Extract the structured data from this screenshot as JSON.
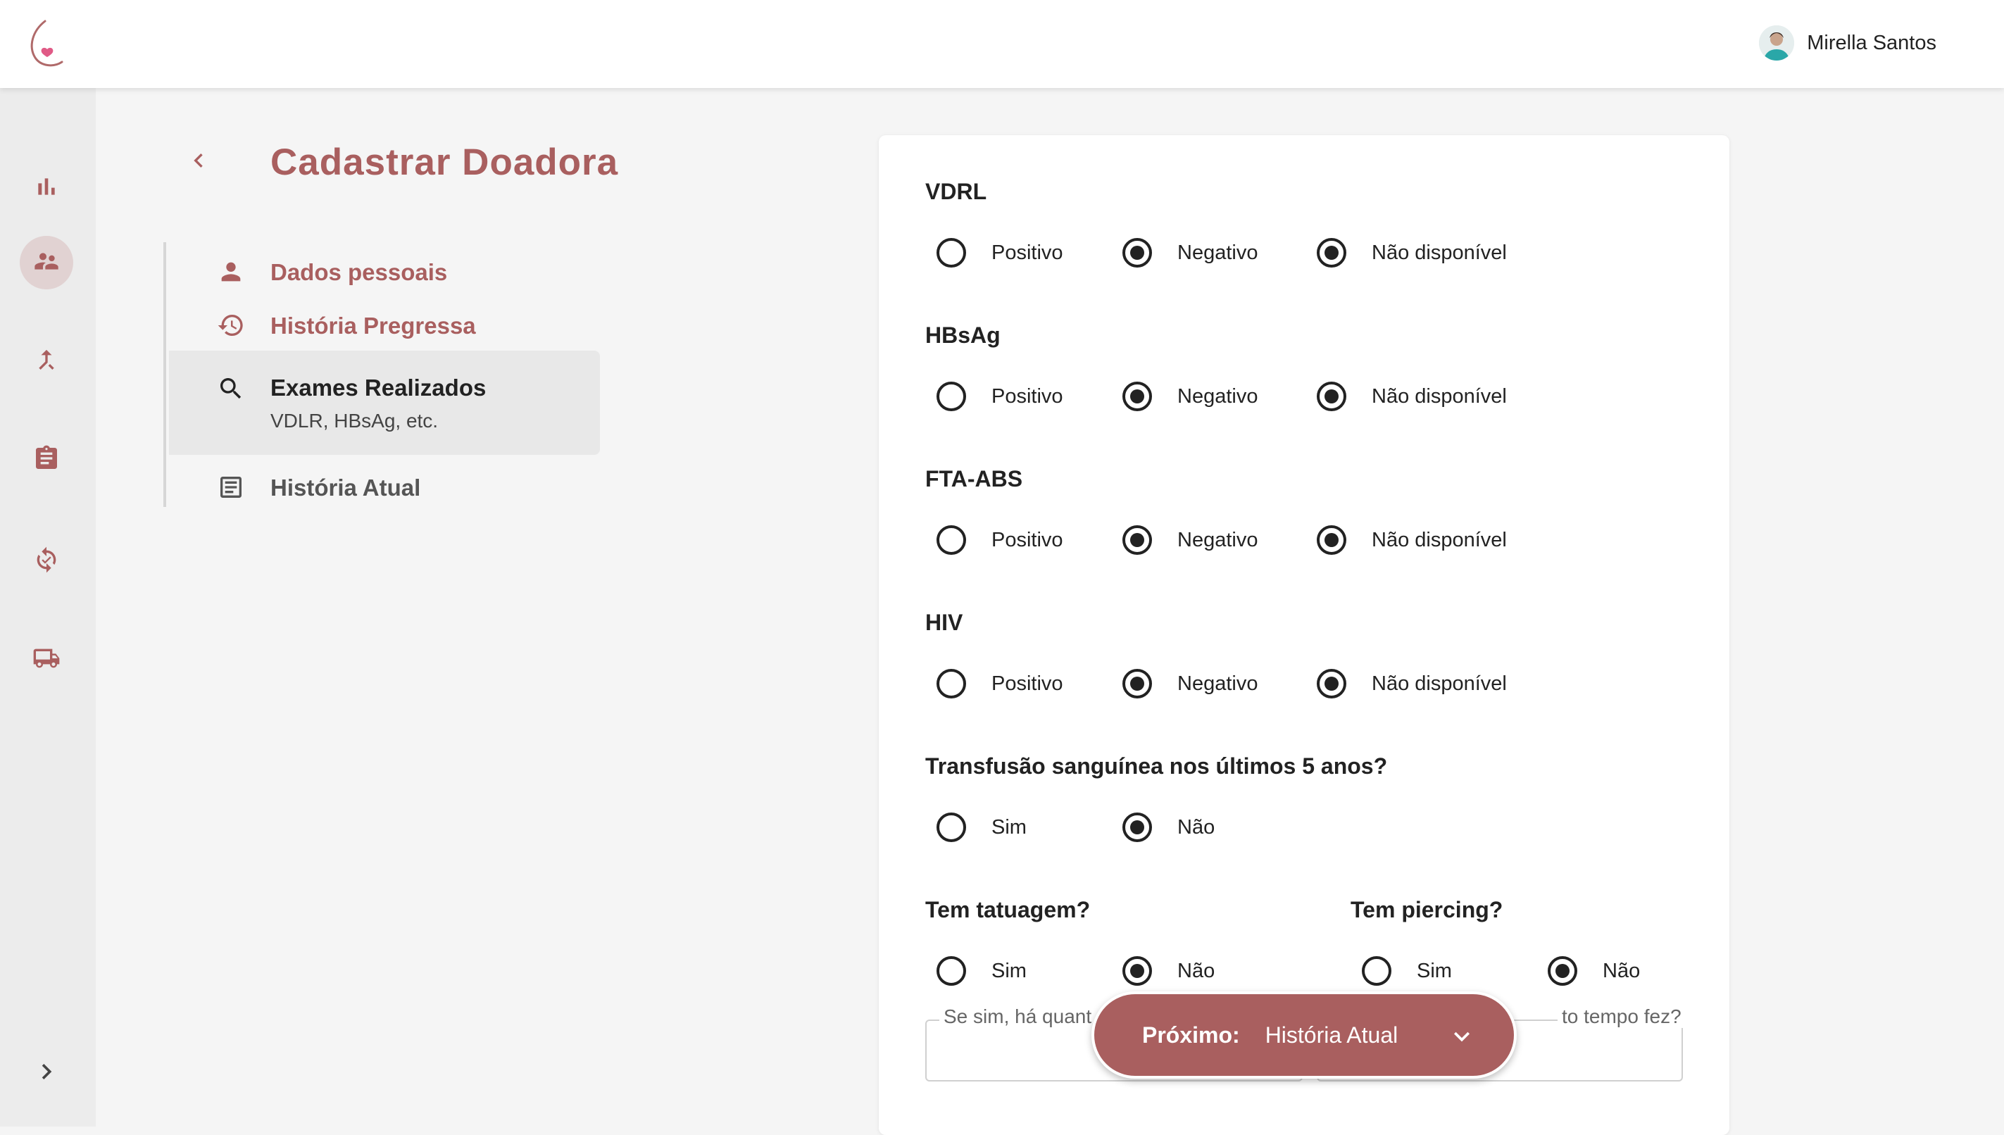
{
  "user": {
    "name": "Mirella Santos"
  },
  "page": {
    "title": "Cadastrar Doadora"
  },
  "steps": [
    {
      "label": "Dados pessoais",
      "sub": "",
      "icon": "person-icon",
      "state": "done"
    },
    {
      "label": "História Pregressa",
      "sub": "",
      "icon": "history-icon",
      "state": "done"
    },
    {
      "label": "Exames Realizados",
      "sub": "VDLR, HBsAg, etc.",
      "icon": "search-icon",
      "state": "current"
    },
    {
      "label": "História Atual",
      "sub": "",
      "icon": "article-icon",
      "state": "todo"
    }
  ],
  "rail": [
    {
      "icon": "bar-chart-icon",
      "active": false
    },
    {
      "icon": "people-icon",
      "active": true
    },
    {
      "icon": "merge-icon",
      "active": false
    },
    {
      "icon": "clipboard-icon",
      "active": false
    },
    {
      "icon": "sync-check-icon",
      "active": false
    },
    {
      "icon": "truck-icon",
      "active": false
    }
  ],
  "questions": {
    "vdrl": {
      "label": "VDRL",
      "options": [
        "Positivo",
        "Negativo",
        "Não disponível"
      ],
      "checked": [
        "Negativo",
        "Não disponível"
      ]
    },
    "hbsag": {
      "label": "HBsAg",
      "options": [
        "Positivo",
        "Negativo",
        "Não disponível"
      ],
      "checked": [
        "Negativo",
        "Não disponível"
      ]
    },
    "fta": {
      "label": "FTA-ABS",
      "options": [
        "Positivo",
        "Negativo",
        "Não disponível"
      ],
      "checked": [
        "Negativo",
        "Não disponível"
      ]
    },
    "hiv": {
      "label": "HIV",
      "options": [
        "Positivo",
        "Negativo",
        "Não disponível"
      ],
      "checked": [
        "Negativo",
        "Não disponível"
      ]
    },
    "transfusao": {
      "label": "Transfusão sanguínea nos últimos 5 anos?",
      "options": [
        "Sim",
        "Não"
      ],
      "checked": [
        "Não"
      ]
    },
    "tatuagem": {
      "label": "Tem tatuagem?",
      "options": [
        "Sim",
        "Não"
      ],
      "checked": [
        "Não"
      ]
    },
    "piercing": {
      "label": "Tem piercing?",
      "options": [
        "Sim",
        "Não"
      ],
      "checked": [
        "Não"
      ]
    }
  },
  "fields": {
    "tatuagem_tempo": {
      "label": "Se sim, há quant",
      "value": ""
    },
    "piercing_tempo": {
      "label": "to tempo fez?",
      "value": ""
    }
  },
  "next": {
    "prefix": "Próximo:",
    "value": "História Atual"
  },
  "colors": {
    "accent": "#a95f5f",
    "rail_active": "#e1d2d2"
  }
}
